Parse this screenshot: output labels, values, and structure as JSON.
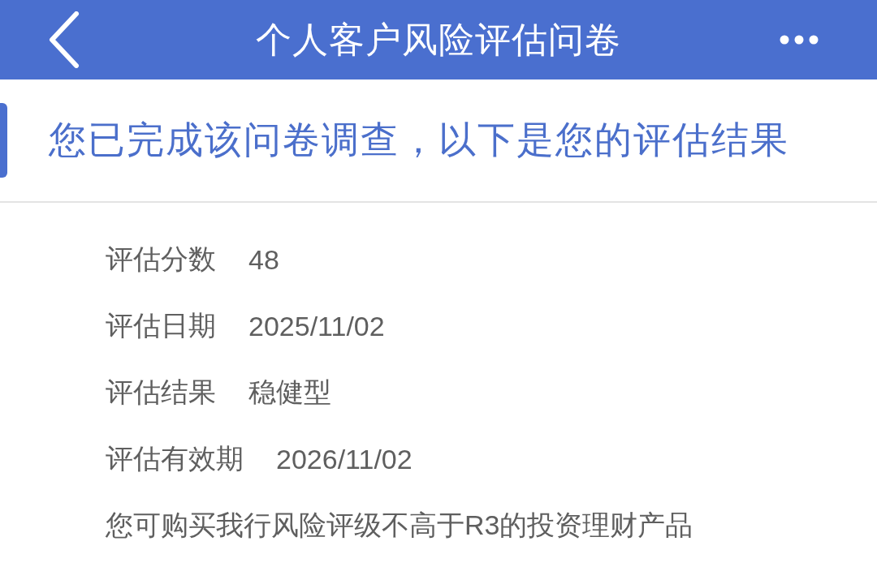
{
  "header": {
    "title": "个人客户风险评估问卷"
  },
  "banner": {
    "heading": "您已完成该问卷调查，以下是您的评估结果"
  },
  "result_fields": [
    {
      "label": "评估分数",
      "value": "48"
    },
    {
      "label": "评估日期",
      "value": "2025/11/02"
    },
    {
      "label": "评估结果",
      "value": "稳健型"
    },
    {
      "label": "评估有效期",
      "value": "2026/11/02"
    }
  ],
  "notice": "您可购买我行风险评级不高于R3的投资理财产品"
}
